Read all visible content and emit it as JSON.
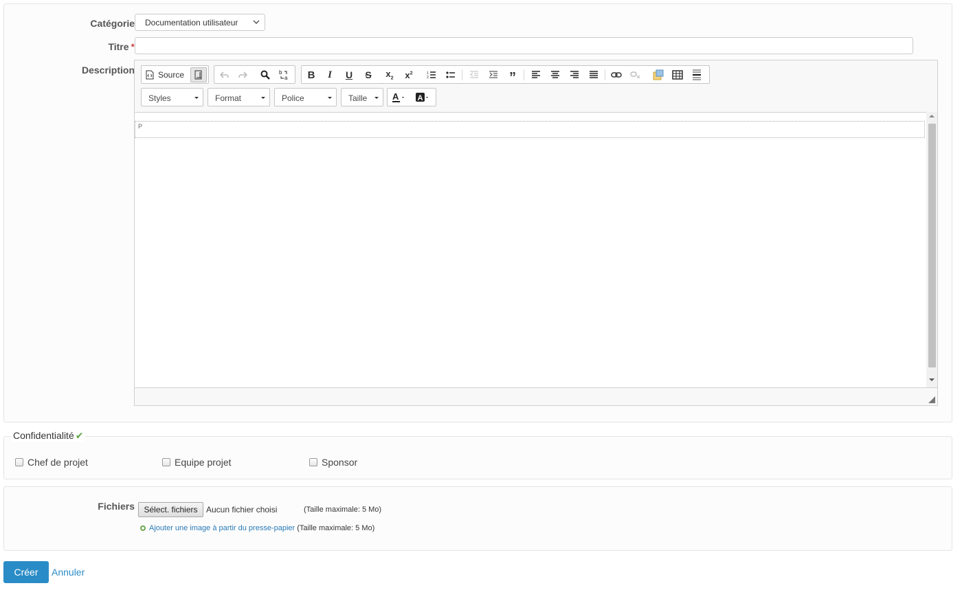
{
  "form": {
    "category_label": "Catégorie",
    "category_value": "Documentation utilisateur",
    "title_label": "Titre",
    "required_mark": "*",
    "title_value": "",
    "description_label": "Description"
  },
  "editor": {
    "source_label": "Source",
    "combos": {
      "styles": "Styles",
      "format": "Format",
      "font": "Police",
      "size": "Taille"
    },
    "block_tag": "P",
    "icons": {
      "source": "source-code-icon",
      "maximize": "maximize-icon",
      "undo": "undo-icon",
      "redo": "redo-icon",
      "find": "find-icon",
      "replace": "replace-icon",
      "bold": "bold-icon",
      "italic": "italic-icon",
      "underline": "underline-icon",
      "strike": "strikethrough-icon",
      "subscript": "subscript-icon",
      "superscript": "superscript-icon",
      "ordered_list": "numbered-list-icon",
      "bullet_list": "bulleted-list-icon",
      "outdent": "outdent-icon",
      "indent": "indent-icon",
      "blockquote": "blockquote-icon",
      "align_left": "align-left-icon",
      "align_center": "align-center-icon",
      "align_right": "align-right-icon",
      "justify": "justify-icon",
      "link": "link-icon",
      "unlink": "unlink-icon",
      "image": "image-icon",
      "table": "table-icon",
      "hr": "horizontal-rule-icon",
      "text_color": "text-color-icon",
      "bg_color": "background-color-icon"
    }
  },
  "confidentiality": {
    "legend": "Confidentialité",
    "check_mark": "✔",
    "options": [
      {
        "label": "Chef de projet",
        "checked": false
      },
      {
        "label": "Equipe projet",
        "checked": false
      },
      {
        "label": "Sponsor",
        "checked": false
      }
    ]
  },
  "files": {
    "label": "Fichiers",
    "button_label": "Sélect. fichiers",
    "no_file_text": "Aucun fichier choisi",
    "max_size_text": "(Taille maximale: 5 Mo)",
    "paste_link": "Ajouter une image à partir du presse-papier",
    "paste_max_size": "(Taille maximale: 5 Mo)"
  },
  "actions": {
    "create_label": "Créer",
    "cancel_label": "Annuler"
  },
  "colors": {
    "primary": "#2a8cc6",
    "required": "#bb0000",
    "check": "#5aa544",
    "link": "#2a7ab7"
  }
}
